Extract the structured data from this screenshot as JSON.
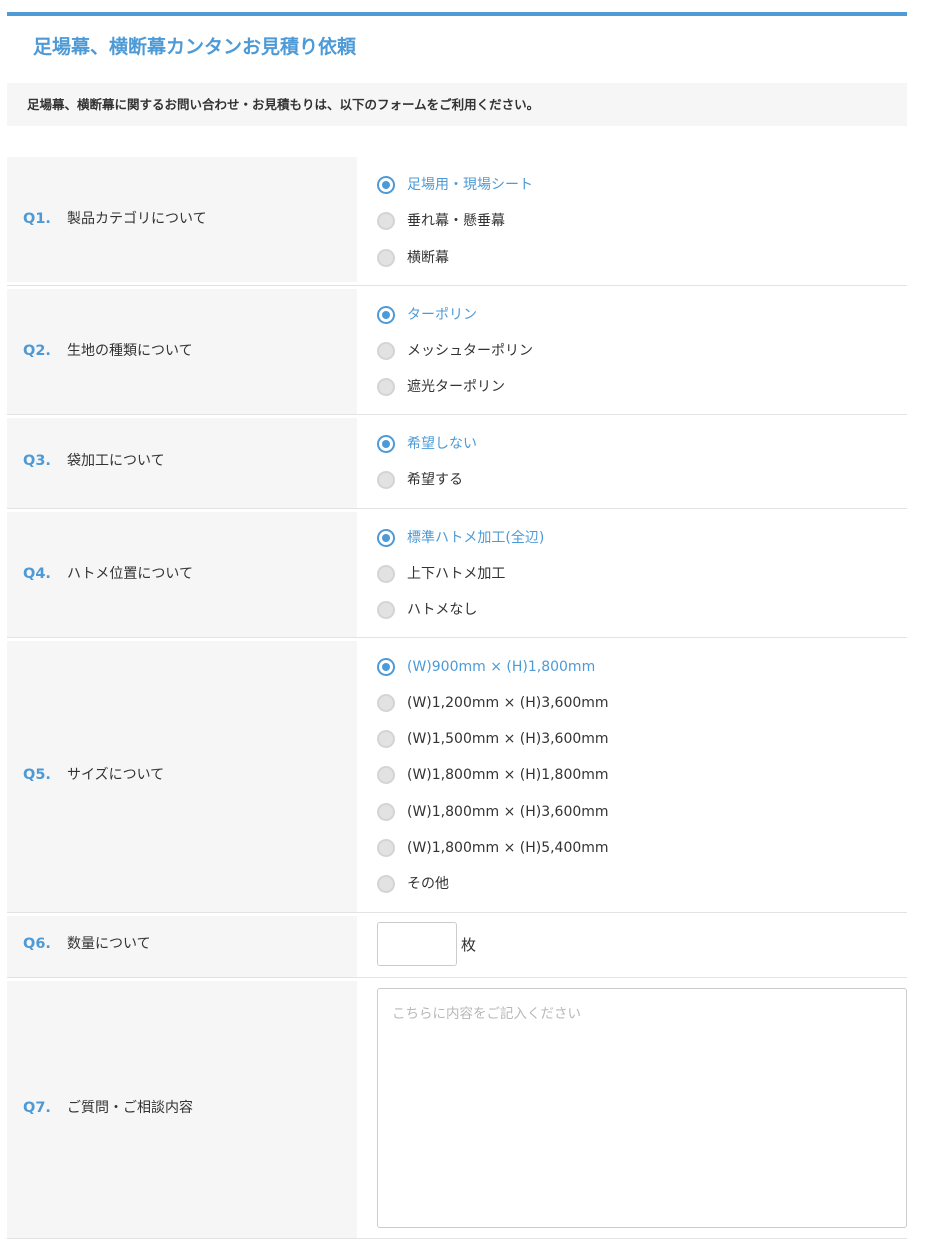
{
  "header": {
    "title": "足場幕、横断幕カンタンお見積り依頼",
    "intro": "足場幕、横断幕に関するお問い合わせ・お見積もりは、以下のフォームをご利用ください。"
  },
  "colors": {
    "accent": "#4d9ad6",
    "label_bg": "#f6f6f6",
    "divider": "#e3e3e3"
  },
  "questions": {
    "q1": {
      "num": "Q1.",
      "label": "製品カテゴリについて",
      "options": [
        "足場用・現場シート",
        "垂れ幕・懸垂幕",
        "横断幕"
      ],
      "selected": "足場用・現場シート"
    },
    "q2": {
      "num": "Q2.",
      "label": "生地の種類について",
      "options": [
        "ターポリン",
        "メッシュターポリン",
        "遮光ターポリン"
      ],
      "selected": "ターポリン"
    },
    "q3": {
      "num": "Q3.",
      "label": "袋加工について",
      "options": [
        "希望しない",
        "希望する"
      ],
      "selected": "希望しない"
    },
    "q4": {
      "num": "Q4.",
      "label": "ハトメ位置について",
      "options": [
        "標準ハトメ加工(全辺)",
        "上下ハトメ加工",
        "ハトメなし"
      ],
      "selected": "標準ハトメ加工(全辺)"
    },
    "q5": {
      "num": "Q5.",
      "label": "サイズについて",
      "options": [
        "(W)900mm × (H)1,800mm",
        "(W)1,200mm × (H)3,600mm",
        "(W)1,500mm × (H)3,600mm",
        "(W)1,800mm × (H)1,800mm",
        "(W)1,800mm × (H)3,600mm",
        "(W)1,800mm × (H)5,400mm",
        "その他"
      ],
      "selected": "(W)900mm × (H)1,800mm"
    },
    "q6": {
      "num": "Q6.",
      "label": "数量について",
      "value": "",
      "unit": "枚"
    },
    "q7": {
      "num": "Q7.",
      "label": "ご質問・ご相談内容",
      "value": "",
      "placeholder": "こちらに内容をご記入ください"
    }
  }
}
